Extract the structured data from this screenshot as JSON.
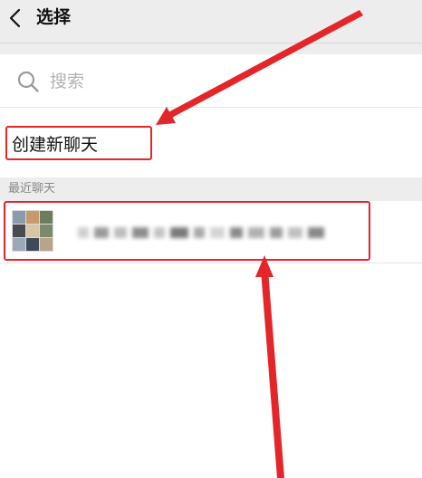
{
  "header": {
    "title": "选择",
    "back_icon": "chevron-left-icon"
  },
  "search": {
    "placeholder": "搜索",
    "icon": "search-icon"
  },
  "create_chat": {
    "label": "创建新聊天"
  },
  "recent": {
    "section_title": "最近聊天",
    "chats": [
      {
        "avatar": "group-avatar",
        "name_blurred": true
      }
    ]
  },
  "annotation_colors": {
    "highlight": "#e4262a",
    "arrow": "#e4262a"
  },
  "theme": {
    "header_bg": "#ededed",
    "section_bg": "#ededed",
    "text_primary": "#111111",
    "text_secondary": "#888888",
    "placeholder": "#b3b3b3"
  }
}
